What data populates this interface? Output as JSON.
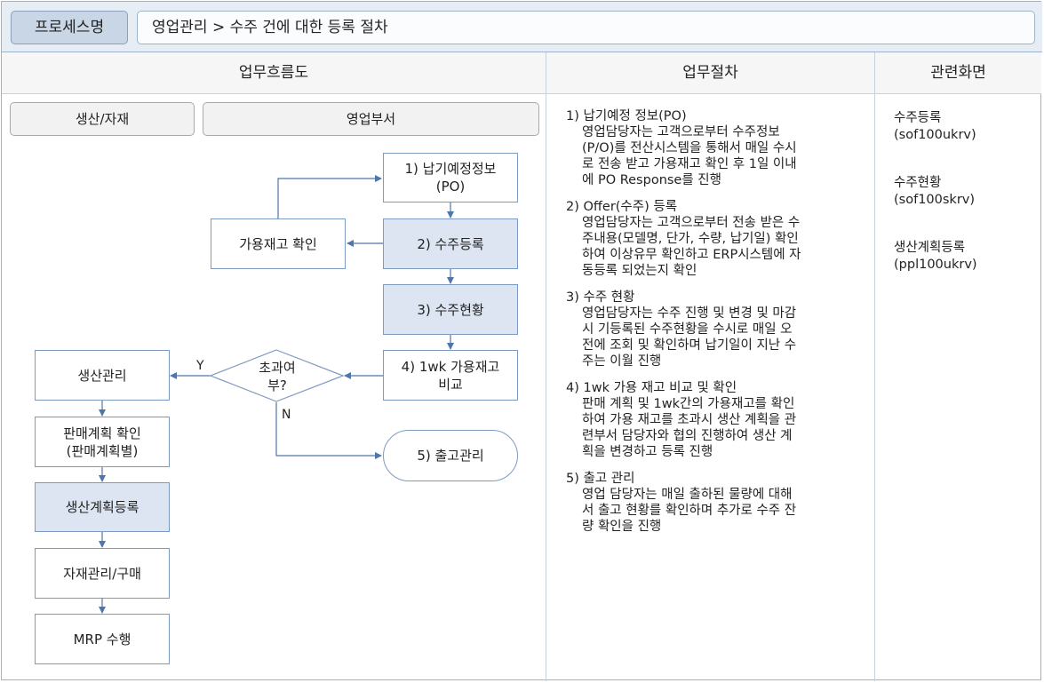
{
  "header": {
    "process_label": "프로세스명",
    "process_title": "영업관리 > 수주 건에 대한 등록 절차"
  },
  "columns": {
    "flow": "업무흐름도",
    "procedure": "업무절차",
    "screens": "관련화면"
  },
  "lanes": {
    "production": "생산/자재",
    "sales": "영업부서"
  },
  "flow": {
    "po_info_1": "1) 납기예정정보",
    "po_info_2": "(PO)",
    "order_reg": "2) 수주등록",
    "stock_check": "가용재고 확인",
    "order_status": "3) 수주현황",
    "compare_1": "4) 1wk 가용재고",
    "compare_2": "비교",
    "decision_1": "초과여",
    "decision_2": "부?",
    "yes": "Y",
    "no": "N",
    "shipping": "5) 출고관리",
    "prod_mgmt": "생산관리",
    "sales_plan_1": "판매계획 확인",
    "sales_plan_2": "(판매계획별)",
    "prod_plan_reg": "생산계획등록",
    "material": "자재관리/구매",
    "mrp": "MRP 수행"
  },
  "procedure": [
    {
      "title": "1) 납기예정 정보(PO)",
      "lines": [
        "영업담당자는 고객으로부터 수주정보",
        "(P/O)를 전산시스템을 통해서 매일 수시",
        "로 전송 받고 가용재고 확인 후 1일 이내",
        "에 PO Response를 진행"
      ]
    },
    {
      "title": "2) Offer(수주) 등록",
      "lines": [
        "영업담당자는 고객으로부터 전송 받은 수",
        "주내용(모델명, 단가, 수량, 납기일) 확인",
        "하여 이상유무 확인하고 ERP시스템에 자",
        "동등록 되었는지 확인"
      ]
    },
    {
      "title": "3) 수주 현황",
      "lines": [
        "영업담당자는 수주 진행 및 변경 및 마감",
        "시 기등록된 수주현황을  수시로 매일 오",
        "전에 조회 및 확인하며 납기일이 지난 수",
        "주는 이월 진행"
      ]
    },
    {
      "title": "4) 1wk 가용 재고 비교 및 확인",
      "lines": [
        "판매 계획 및  1wk간의 가용재고를 확인",
        "하여 가용 재고를 초과시 생산 계획을 관",
        "련부서 담당자와 협의 진행하여 생산 계",
        "획을 변경하고 등록 진행"
      ]
    },
    {
      "title": "5) 출고 관리",
      "lines": [
        "영업 담당자는 매일 출하된 물량에 대해",
        "서 출고 현황를 확인하며 추가로 수주 잔",
        "량 확인을 진행"
      ]
    }
  ],
  "screens": [
    {
      "name": "수주등록",
      "code": "(sof100ukrv)"
    },
    {
      "name": "수주현황",
      "code": "(sof100skrv)"
    },
    {
      "name": "생산계획등록",
      "code": "(ppl100ukrv)"
    }
  ]
}
